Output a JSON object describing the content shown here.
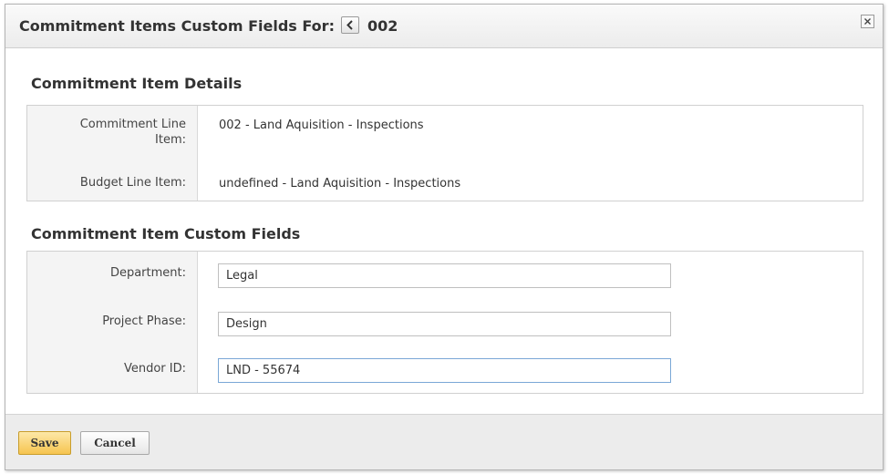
{
  "dialog": {
    "title": "Commitment Items Custom Fields For:",
    "record_id": "002",
    "prev_icon": "chevron-left-icon",
    "close_icon": "close-icon"
  },
  "details": {
    "heading": "Commitment Item Details",
    "rows": [
      {
        "label": "Commitment Line Item:",
        "value": "002 - Land Aquisition - Inspections"
      },
      {
        "label": "Budget Line Item:",
        "value": "undefined - Land Aquisition - Inspections"
      }
    ]
  },
  "custom_fields": {
    "heading": "Commitment Item Custom Fields",
    "fields": [
      {
        "label": "Department:",
        "value": "Legal"
      },
      {
        "label": "Project Phase:",
        "value": "Design"
      },
      {
        "label": "Vendor ID:",
        "value": "LND - 55674"
      }
    ]
  },
  "footer": {
    "save_label": "Save",
    "cancel_label": "Cancel"
  },
  "colors": {
    "save_button": "#f6c44f",
    "focus_border": "#7aa7d6",
    "label_column_bg": "#f4f4f4"
  }
}
